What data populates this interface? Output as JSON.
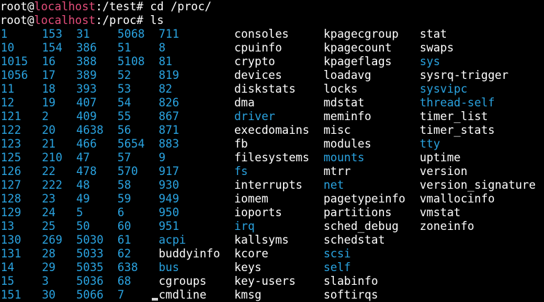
{
  "colors": {
    "background": "#000000",
    "text": "#ffffff",
    "directory": "#2aa3e0",
    "host": "#e34d7a"
  },
  "history": [
    {
      "user": "root@",
      "host": "localhost",
      "cwd": ":/test#",
      "command": " cd /proc/"
    },
    {
      "user": "root@",
      "host": "localhost",
      "cwd": ":/proc#",
      "command": " ls"
    }
  ],
  "listing": [
    [
      {
        "t": "1",
        "d": true
      },
      {
        "t": "153",
        "d": true
      },
      {
        "t": "31",
        "d": true
      },
      {
        "t": "5068",
        "d": true
      },
      {
        "t": "711",
        "d": true
      },
      {
        "t": "consoles",
        "d": false
      },
      {
        "t": "kpagecgroup",
        "d": false
      },
      {
        "t": "stat",
        "d": false
      }
    ],
    [
      {
        "t": "10",
        "d": true
      },
      {
        "t": "154",
        "d": true
      },
      {
        "t": "386",
        "d": true
      },
      {
        "t": "51",
        "d": true
      },
      {
        "t": "8",
        "d": true
      },
      {
        "t": "cpuinfo",
        "d": false
      },
      {
        "t": "kpagecount",
        "d": false
      },
      {
        "t": "swaps",
        "d": false
      }
    ],
    [
      {
        "t": "1015",
        "d": true
      },
      {
        "t": "16",
        "d": true
      },
      {
        "t": "388",
        "d": true
      },
      {
        "t": "5108",
        "d": true
      },
      {
        "t": "81",
        "d": true
      },
      {
        "t": "crypto",
        "d": false
      },
      {
        "t": "kpageflags",
        "d": false
      },
      {
        "t": "sys",
        "d": true
      }
    ],
    [
      {
        "t": "1056",
        "d": true
      },
      {
        "t": "17",
        "d": true
      },
      {
        "t": "389",
        "d": true
      },
      {
        "t": "52",
        "d": true
      },
      {
        "t": "819",
        "d": true
      },
      {
        "t": "devices",
        "d": false
      },
      {
        "t": "loadavg",
        "d": false
      },
      {
        "t": "sysrq-trigger",
        "d": false
      }
    ],
    [
      {
        "t": "11",
        "d": true
      },
      {
        "t": "18",
        "d": true
      },
      {
        "t": "393",
        "d": true
      },
      {
        "t": "53",
        "d": true
      },
      {
        "t": "82",
        "d": true
      },
      {
        "t": "diskstats",
        "d": false
      },
      {
        "t": "locks",
        "d": false
      },
      {
        "t": "sysvipc",
        "d": true
      }
    ],
    [
      {
        "t": "12",
        "d": true
      },
      {
        "t": "19",
        "d": true
      },
      {
        "t": "407",
        "d": true
      },
      {
        "t": "54",
        "d": true
      },
      {
        "t": "826",
        "d": true
      },
      {
        "t": "dma",
        "d": false
      },
      {
        "t": "mdstat",
        "d": false
      },
      {
        "t": "thread-self",
        "d": true
      }
    ],
    [
      {
        "t": "121",
        "d": true
      },
      {
        "t": "2",
        "d": true
      },
      {
        "t": "409",
        "d": true
      },
      {
        "t": "55",
        "d": true
      },
      {
        "t": "867",
        "d": true
      },
      {
        "t": "driver",
        "d": true
      },
      {
        "t": "meminfo",
        "d": false
      },
      {
        "t": "timer_list",
        "d": false
      }
    ],
    [
      {
        "t": "122",
        "d": true
      },
      {
        "t": "20",
        "d": true
      },
      {
        "t": "4638",
        "d": true
      },
      {
        "t": "56",
        "d": true
      },
      {
        "t": "871",
        "d": true
      },
      {
        "t": "execdomains",
        "d": false
      },
      {
        "t": "misc",
        "d": false
      },
      {
        "t": "timer_stats",
        "d": false
      }
    ],
    [
      {
        "t": "123",
        "d": true
      },
      {
        "t": "21",
        "d": true
      },
      {
        "t": "466",
        "d": true
      },
      {
        "t": "5654",
        "d": true
      },
      {
        "t": "883",
        "d": true
      },
      {
        "t": "fb",
        "d": false
      },
      {
        "t": "modules",
        "d": false
      },
      {
        "t": "tty",
        "d": true
      }
    ],
    [
      {
        "t": "125",
        "d": true
      },
      {
        "t": "210",
        "d": true
      },
      {
        "t": "47",
        "d": true
      },
      {
        "t": "57",
        "d": true
      },
      {
        "t": "9",
        "d": true
      },
      {
        "t": "filesystems",
        "d": false
      },
      {
        "t": "mounts",
        "d": true
      },
      {
        "t": "uptime",
        "d": false
      }
    ],
    [
      {
        "t": "126",
        "d": true
      },
      {
        "t": "22",
        "d": true
      },
      {
        "t": "478",
        "d": true
      },
      {
        "t": "570",
        "d": true
      },
      {
        "t": "917",
        "d": true
      },
      {
        "t": "fs",
        "d": true
      },
      {
        "t": "mtrr",
        "d": false
      },
      {
        "t": "version",
        "d": false
      }
    ],
    [
      {
        "t": "127",
        "d": true
      },
      {
        "t": "222",
        "d": true
      },
      {
        "t": "48",
        "d": true
      },
      {
        "t": "58",
        "d": true
      },
      {
        "t": "930",
        "d": true
      },
      {
        "t": "interrupts",
        "d": false
      },
      {
        "t": "net",
        "d": true
      },
      {
        "t": "version_signature",
        "d": false
      }
    ],
    [
      {
        "t": "128",
        "d": true
      },
      {
        "t": "23",
        "d": true
      },
      {
        "t": "49",
        "d": true
      },
      {
        "t": "59",
        "d": true
      },
      {
        "t": "949",
        "d": true
      },
      {
        "t": "iomem",
        "d": false
      },
      {
        "t": "pagetypeinfo",
        "d": false
      },
      {
        "t": "vmallocinfo",
        "d": false
      }
    ],
    [
      {
        "t": "129",
        "d": true
      },
      {
        "t": "24",
        "d": true
      },
      {
        "t": "5",
        "d": true
      },
      {
        "t": "6",
        "d": true
      },
      {
        "t": "950",
        "d": true
      },
      {
        "t": "ioports",
        "d": false
      },
      {
        "t": "partitions",
        "d": false
      },
      {
        "t": "vmstat",
        "d": false
      }
    ],
    [
      {
        "t": "13",
        "d": true
      },
      {
        "t": "25",
        "d": true
      },
      {
        "t": "50",
        "d": true
      },
      {
        "t": "60",
        "d": true
      },
      {
        "t": "951",
        "d": true
      },
      {
        "t": "irq",
        "d": true
      },
      {
        "t": "sched_debug",
        "d": false
      },
      {
        "t": "zoneinfo",
        "d": false
      }
    ],
    [
      {
        "t": "130",
        "d": true
      },
      {
        "t": "269",
        "d": true
      },
      {
        "t": "5030",
        "d": true
      },
      {
        "t": "61",
        "d": true
      },
      {
        "t": "acpi",
        "d": true
      },
      {
        "t": "kallsyms",
        "d": false
      },
      {
        "t": "schedstat",
        "d": false
      },
      {
        "t": "",
        "d": false
      }
    ],
    [
      {
        "t": "131",
        "d": true
      },
      {
        "t": "28",
        "d": true
      },
      {
        "t": "5033",
        "d": true
      },
      {
        "t": "62",
        "d": true
      },
      {
        "t": "buddyinfo",
        "d": false
      },
      {
        "t": "kcore",
        "d": false
      },
      {
        "t": "scsi",
        "d": true
      },
      {
        "t": "",
        "d": false
      }
    ],
    [
      {
        "t": "14",
        "d": true
      },
      {
        "t": "29",
        "d": true
      },
      {
        "t": "5035",
        "d": true
      },
      {
        "t": "638",
        "d": true
      },
      {
        "t": "bus",
        "d": true
      },
      {
        "t": "keys",
        "d": false
      },
      {
        "t": "self",
        "d": true
      },
      {
        "t": "",
        "d": false
      }
    ],
    [
      {
        "t": "15",
        "d": true
      },
      {
        "t": "3",
        "d": true
      },
      {
        "t": "5036",
        "d": true
      },
      {
        "t": "68",
        "d": true
      },
      {
        "t": "cgroups",
        "d": false
      },
      {
        "t": "key-users",
        "d": false
      },
      {
        "t": "slabinfo",
        "d": false
      },
      {
        "t": "",
        "d": false
      }
    ],
    [
      {
        "t": "151",
        "d": true
      },
      {
        "t": "30",
        "d": true
      },
      {
        "t": "5066",
        "d": true
      },
      {
        "t": "7",
        "d": true
      },
      {
        "t": "cmdline",
        "d": false
      },
      {
        "t": "kmsg",
        "d": false
      },
      {
        "t": "softirqs",
        "d": false
      },
      {
        "t": "",
        "d": false
      }
    ]
  ]
}
